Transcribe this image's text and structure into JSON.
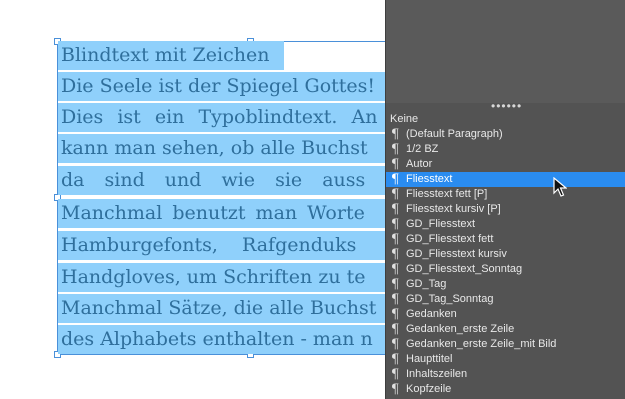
{
  "document": {
    "lines": [
      "Blindtext mit Zeichen",
      "Die Seele ist der Spiegel Gottes!",
      "Dies ist ein Typoblindtext. An",
      "kann man sehen, ob alle Buchst",
      "da sind und wie sie auss",
      "Manchmal benutzt man Worte",
      "Hamburgefonts, Rafgenduks",
      "Handgloves, um Schriften zu te",
      "Manchmal Sätze, die alle Buchst",
      "des Alphabets enthalten - man n"
    ]
  },
  "panel": {
    "grip": "••••••",
    "styles": [
      {
        "label": "Keine",
        "pilcrow": "",
        "selected": false
      },
      {
        "label": "(Default Paragraph)",
        "pilcrow": "¶",
        "selected": false
      },
      {
        "label": "1/2 BZ",
        "pilcrow": "¶",
        "selected": false
      },
      {
        "label": "Autor",
        "pilcrow": "¶",
        "selected": false
      },
      {
        "label": "Fliesstext",
        "pilcrow": "¶",
        "selected": true
      },
      {
        "label": "Fliesstext fett [P]",
        "pilcrow": "¶",
        "selected": false
      },
      {
        "label": "Fliesstext kursiv [P]",
        "pilcrow": "¶",
        "selected": false
      },
      {
        "label": "GD_Fliesstext",
        "pilcrow": "¶",
        "selected": false
      },
      {
        "label": "GD_Fliesstext fett",
        "pilcrow": "¶",
        "selected": false
      },
      {
        "label": "GD_Fliesstext kursiv",
        "pilcrow": "¶",
        "selected": false
      },
      {
        "label": "GD_Fliesstext_Sonntag",
        "pilcrow": "¶",
        "selected": false
      },
      {
        "label": "GD_Tag",
        "pilcrow": "¶",
        "selected": false
      },
      {
        "label": "GD_Tag_Sonntag",
        "pilcrow": "¶",
        "selected": false
      },
      {
        "label": "Gedanken",
        "pilcrow": "¶",
        "selected": false
      },
      {
        "label": "Gedanken_erste Zeile",
        "pilcrow": "¶",
        "selected": false
      },
      {
        "label": "Gedanken_erste Zeile_mit Bild",
        "pilcrow": "¶",
        "selected": false
      },
      {
        "label": "Haupttitel",
        "pilcrow": "¶",
        "selected": false
      },
      {
        "label": "Inhaltszeilen",
        "pilcrow": "¶",
        "selected": false
      },
      {
        "label": "Kopfzeile",
        "pilcrow": "¶",
        "selected": false
      }
    ]
  },
  "colors": {
    "selection_highlight": "#8fd0fb",
    "frame_border": "#4a90d9",
    "panel_background": "#535353",
    "selected_row": "#2a8cf0"
  }
}
